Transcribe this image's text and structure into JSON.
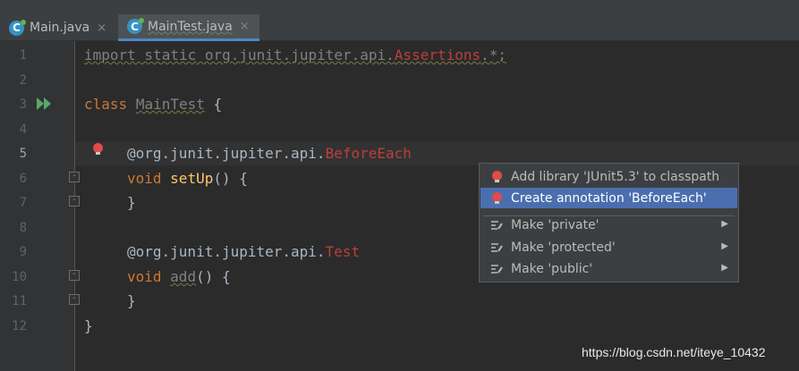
{
  "tabs": [
    {
      "label": "Main.java",
      "icon": "java-class-icon",
      "close": "×"
    },
    {
      "label": "MainTest.java",
      "icon": "java-class-icon",
      "close": "×"
    }
  ],
  "line_numbers": [
    "1",
    "2",
    "3",
    "4",
    "5",
    "6",
    "7",
    "8",
    "9",
    "10",
    "11",
    "12"
  ],
  "code": {
    "l1": {
      "import_kw": "import static",
      "path": " org.junit.jupiter.api.",
      "cls": "Assertions",
      "tail": ".*;"
    },
    "l3": {
      "kw": "class",
      "name": "MainTest",
      "brace": " {"
    },
    "l5": {
      "prefix": "@org.junit.jupiter.api.",
      "ann": "BeforeEach"
    },
    "l6": {
      "kw": "void",
      "fn": "setUp",
      "tail": "() {"
    },
    "l7": {
      "brace": "}"
    },
    "l9": {
      "prefix": "@org.junit.jupiter.api.",
      "ann": "Test"
    },
    "l10": {
      "kw": "void",
      "fn": "add",
      "tail": "() {"
    },
    "l11": {
      "brace": "}"
    },
    "l12": {
      "brace": "}"
    }
  },
  "popup": {
    "items": [
      {
        "label": "Add library 'JUnit5.3' to classpath",
        "icon": "red-bulb-icon"
      },
      {
        "label": "Create annotation 'BeforeEach'",
        "icon": "red-bulb-icon"
      },
      {
        "label": "Make 'private'",
        "icon": "intention-icon",
        "submenu": "▶"
      },
      {
        "label": "Make 'protected'",
        "icon": "intention-icon",
        "submenu": "▶"
      },
      {
        "label": "Make 'public'",
        "icon": "intention-icon",
        "submenu": "▶"
      }
    ]
  },
  "watermark": "https://blog.csdn.net/iteye_10432",
  "colors": {
    "background": "#2b2b2b",
    "keyword": "#cc7832",
    "error": "#bc3f3c",
    "selection": "#4b6eaf"
  }
}
